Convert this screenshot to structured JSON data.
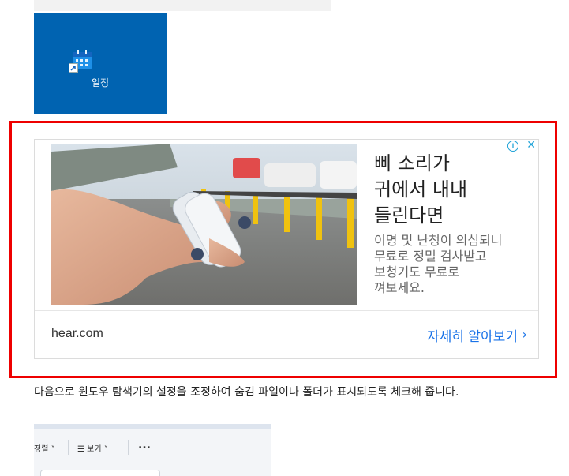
{
  "desktop_shortcut": {
    "label": "일정"
  },
  "ad": {
    "headline": "삐 소리가\n귀에서 내내\n들린다면",
    "description": "이명 및 난청이 의심되니\n무료로 정밀 검사받고\n보청기도 무료로\n껴보세요.",
    "domain": "hear.com",
    "cta": "자세히 알아보기",
    "adchoices_icon": "info-icon",
    "close_icon": "close-icon",
    "colors": {
      "frame": "#ee0000",
      "cta": "#1a73e8"
    }
  },
  "article": {
    "paragraph": "다음으로 윈도우 탐색기의 설정을 조정하여 숨김 파일이나 폴더가 표시되도록 체크해 줍니다."
  },
  "explorer_toolbar": {
    "sort_label": "정렬",
    "view_label": "보기",
    "more_label": "..."
  }
}
